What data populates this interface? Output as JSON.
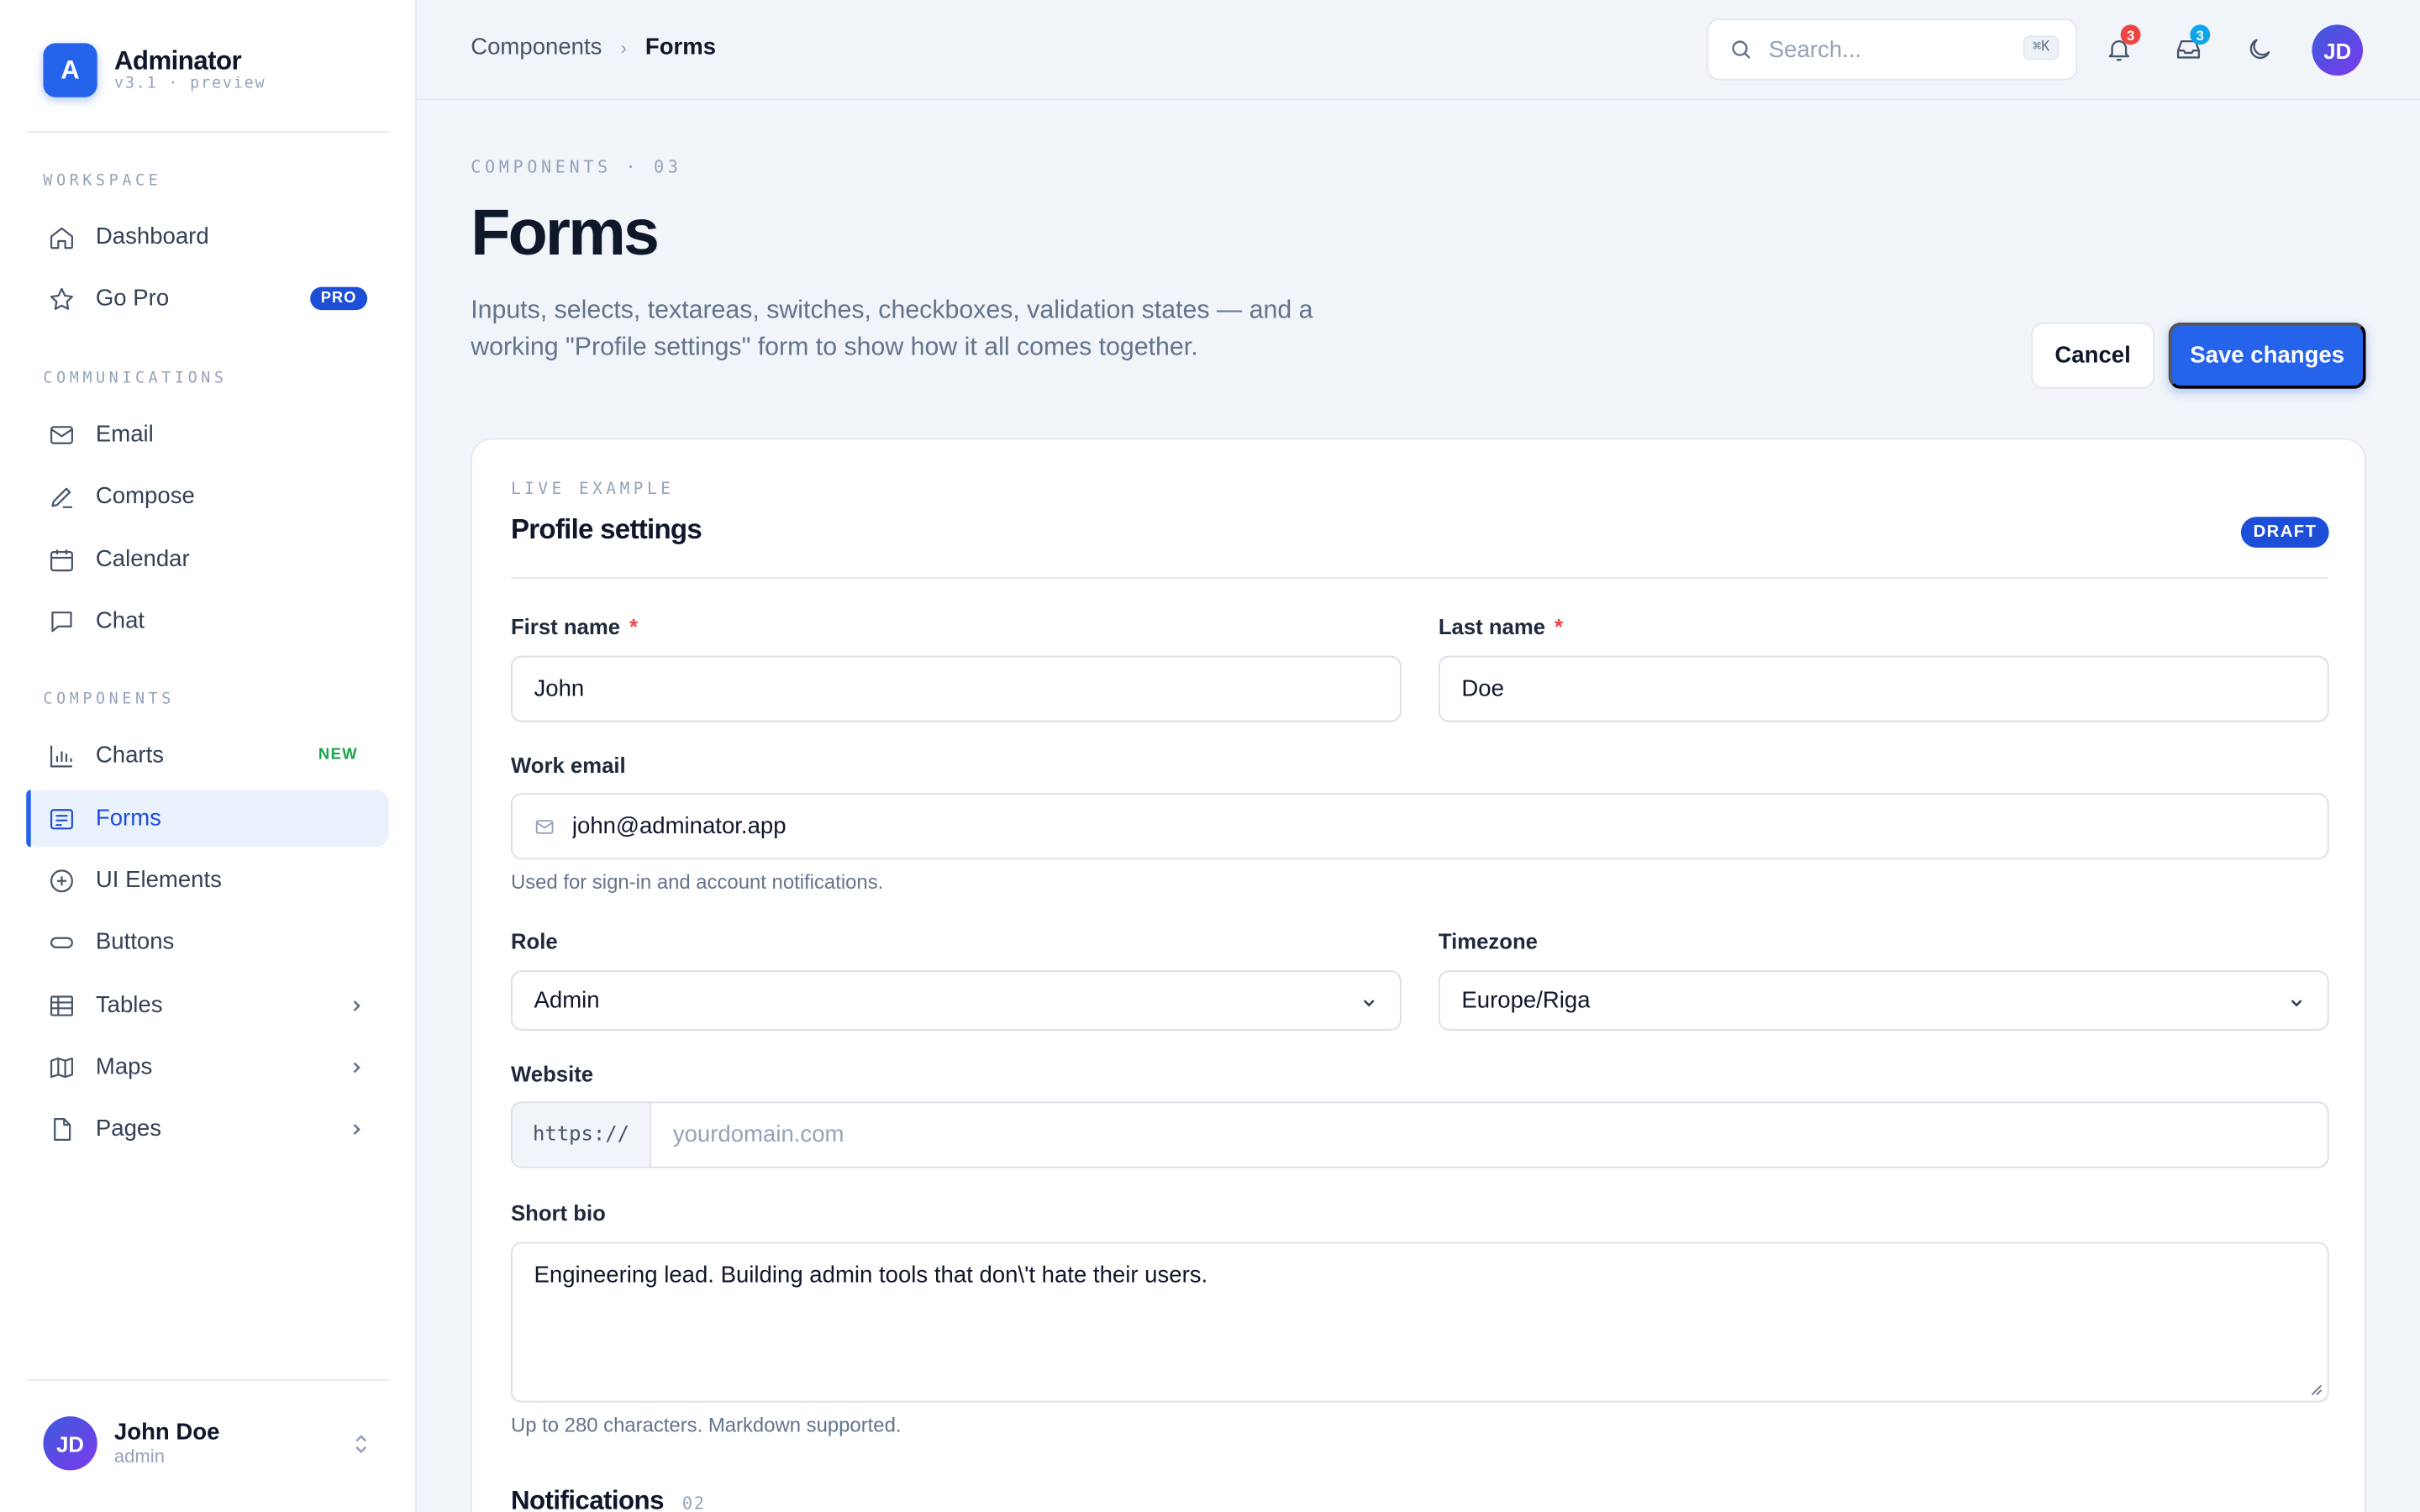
{
  "brand": {
    "logo_letter": "A",
    "name": "Adminator",
    "version": "v3.1 · preview"
  },
  "sidebar": {
    "sections": [
      "WORKSPACE",
      "COMMUNICATIONS",
      "COMPONENTS"
    ],
    "items": [
      {
        "label": "Dashboard",
        "icon": "home-icon"
      },
      {
        "label": "Go Pro",
        "icon": "star-icon",
        "badge": "PRO"
      },
      {
        "label": "Email",
        "icon": "mail-icon"
      },
      {
        "label": "Compose",
        "icon": "pencil-icon"
      },
      {
        "label": "Calendar",
        "icon": "calendar-icon"
      },
      {
        "label": "Chat",
        "icon": "chat-icon"
      },
      {
        "label": "Charts",
        "icon": "bar-chart-icon",
        "badge": "NEW"
      },
      {
        "label": "Forms",
        "icon": "form-icon",
        "active": true
      },
      {
        "label": "UI Elements",
        "icon": "plus-circle-icon"
      },
      {
        "label": "Buttons",
        "icon": "button-icon"
      },
      {
        "label": "Tables",
        "icon": "table-icon",
        "has_children": true
      },
      {
        "label": "Maps",
        "icon": "map-icon",
        "has_children": true
      },
      {
        "label": "Pages",
        "icon": "file-icon",
        "has_children": true
      }
    ],
    "user": {
      "initials": "JD",
      "name": "John Doe",
      "role": "admin"
    }
  },
  "topbar": {
    "breadcrumb": [
      "Components",
      "Forms"
    ],
    "search_placeholder": "Search...",
    "search_shortcut": "⌘K",
    "notifications_count": "3",
    "inbox_count": "3",
    "avatar_initials": "JD"
  },
  "page": {
    "eyebrow": "COMPONENTS · 03",
    "title": "Forms",
    "description": "Inputs, selects, textareas, switches, checkboxes, validation states — and a working \"Profile settings\" form to show how it all comes together.",
    "cancel_label": "Cancel",
    "save_label": "Save changes"
  },
  "form": {
    "eyebrow": "LIVE EXAMPLE",
    "title": "Profile settings",
    "status_badge": "DRAFT",
    "first_name": {
      "label": "First name",
      "required": "*",
      "value": "John"
    },
    "last_name": {
      "label": "Last name",
      "required": "*",
      "value": "Doe"
    },
    "work_email": {
      "label": "Work email",
      "value": "john@adminator.app",
      "help": "Used for sign-in and account notifications."
    },
    "role": {
      "label": "Role",
      "value": "Admin"
    },
    "timezone": {
      "label": "Timezone",
      "value": "Europe/Riga"
    },
    "website": {
      "label": "Website",
      "prefix": "https://",
      "placeholder": "yourdomain.com"
    },
    "bio": {
      "label": "Short bio",
      "value": "Engineering lead. Building admin tools that don\\'t hate their users.",
      "help": "Up to 280 characters. Markdown supported."
    },
    "notifications": {
      "title": "Notifications",
      "count": "02"
    }
  },
  "colors": {
    "accent": "#2563eb",
    "danger": "#ef4444",
    "info": "#0ea5e9",
    "success": "#16a34a"
  }
}
